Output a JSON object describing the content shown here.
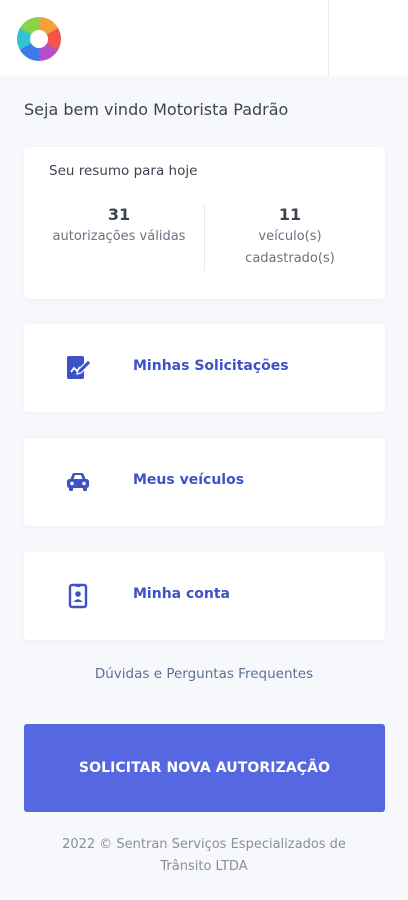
{
  "header": {
    "logo_icon": "swirl-logo"
  },
  "welcome": "Seja bem vindo Motorista Padrão",
  "summary": {
    "title": "Seu resumo para hoje",
    "stats": [
      {
        "value": "31",
        "label": "autorizações válidas"
      },
      {
        "value": "11",
        "label_line1": "veículo(s)",
        "label_line2": "cadastrado(s)"
      }
    ]
  },
  "menu": [
    {
      "label": "Minhas Solicitações",
      "icon": "edit-document-icon"
    },
    {
      "label": "Meus veículos",
      "icon": "car-icon"
    },
    {
      "label": "Minha conta",
      "icon": "id-badge-icon"
    }
  ],
  "faq_link": "Dúvidas e Perguntas Frequentes",
  "cta_label": "SOLICITAR NOVA AUTORIZAÇÃO",
  "footer": {
    "line1": "2022 © Sentran Serviços Especializados de",
    "line2": "Trânsito LTDA"
  },
  "colors": {
    "accent": "#3e52c7",
    "button": "#5568e1",
    "background": "#f7f8fc"
  }
}
